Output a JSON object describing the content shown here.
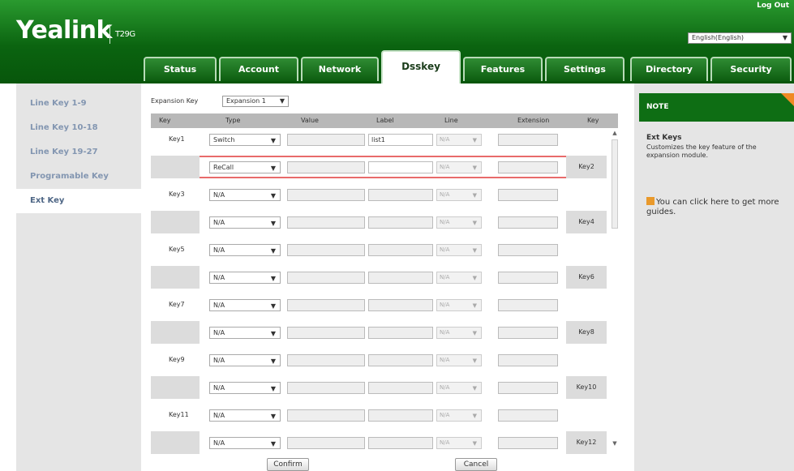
{
  "header": {
    "logo": "Yealink",
    "model": "T29G",
    "logout": "Log Out",
    "language": "English(English)",
    "tabs": [
      "Status",
      "Account",
      "Network",
      "Dsskey",
      "Features",
      "Settings",
      "Directory",
      "Security"
    ],
    "active_tab": "Dsskey"
  },
  "sidebar": {
    "items": [
      "Line Key 1-9",
      "Line Key 10-18",
      "Line Key 19-27",
      "Programable Key",
      "Ext Key"
    ],
    "active": "Ext Key"
  },
  "expansion": {
    "label": "Expansion Key",
    "value": "Expansion 1"
  },
  "table": {
    "headers": [
      "Key",
      "Type",
      "Value",
      "Label",
      "Line",
      "Extension",
      "Key"
    ],
    "rows": [
      {
        "key_left": "Key1",
        "type": "Switch",
        "value": "",
        "label": "list1",
        "line": "N/A",
        "extension": "",
        "key_right": ""
      },
      {
        "key_left": "",
        "type": "ReCall",
        "value": "",
        "label": "",
        "line": "N/A",
        "extension": "",
        "key_right": "Key2"
      },
      {
        "key_left": "Key3",
        "type": "N/A",
        "value": "",
        "label": "",
        "line": "N/A",
        "extension": "",
        "key_right": ""
      },
      {
        "key_left": "",
        "type": "N/A",
        "value": "",
        "label": "",
        "line": "N/A",
        "extension": "",
        "key_right": "Key4"
      },
      {
        "key_left": "Key5",
        "type": "N/A",
        "value": "",
        "label": "",
        "line": "N/A",
        "extension": "",
        "key_right": ""
      },
      {
        "key_left": "",
        "type": "N/A",
        "value": "",
        "label": "",
        "line": "N/A",
        "extension": "",
        "key_right": "Key6"
      },
      {
        "key_left": "Key7",
        "type": "N/A",
        "value": "",
        "label": "",
        "line": "N/A",
        "extension": "",
        "key_right": ""
      },
      {
        "key_left": "",
        "type": "N/A",
        "value": "",
        "label": "",
        "line": "N/A",
        "extension": "",
        "key_right": "Key8"
      },
      {
        "key_left": "Key9",
        "type": "N/A",
        "value": "",
        "label": "",
        "line": "N/A",
        "extension": "",
        "key_right": ""
      },
      {
        "key_left": "",
        "type": "N/A",
        "value": "",
        "label": "",
        "line": "N/A",
        "extension": "",
        "key_right": "Key10"
      },
      {
        "key_left": "Key11",
        "type": "N/A",
        "value": "",
        "label": "",
        "line": "N/A",
        "extension": "",
        "key_right": ""
      },
      {
        "key_left": "",
        "type": "N/A",
        "value": "",
        "label": "",
        "line": "N/A",
        "extension": "",
        "key_right": "Key12"
      }
    ]
  },
  "buttons": {
    "confirm": "Confirm",
    "cancel": "Cancel"
  },
  "note": {
    "header": "NOTE",
    "title": "Ext Keys",
    "text": "Customizes the key feature of the expansion module.",
    "guide": "You can click here to get more guides."
  }
}
